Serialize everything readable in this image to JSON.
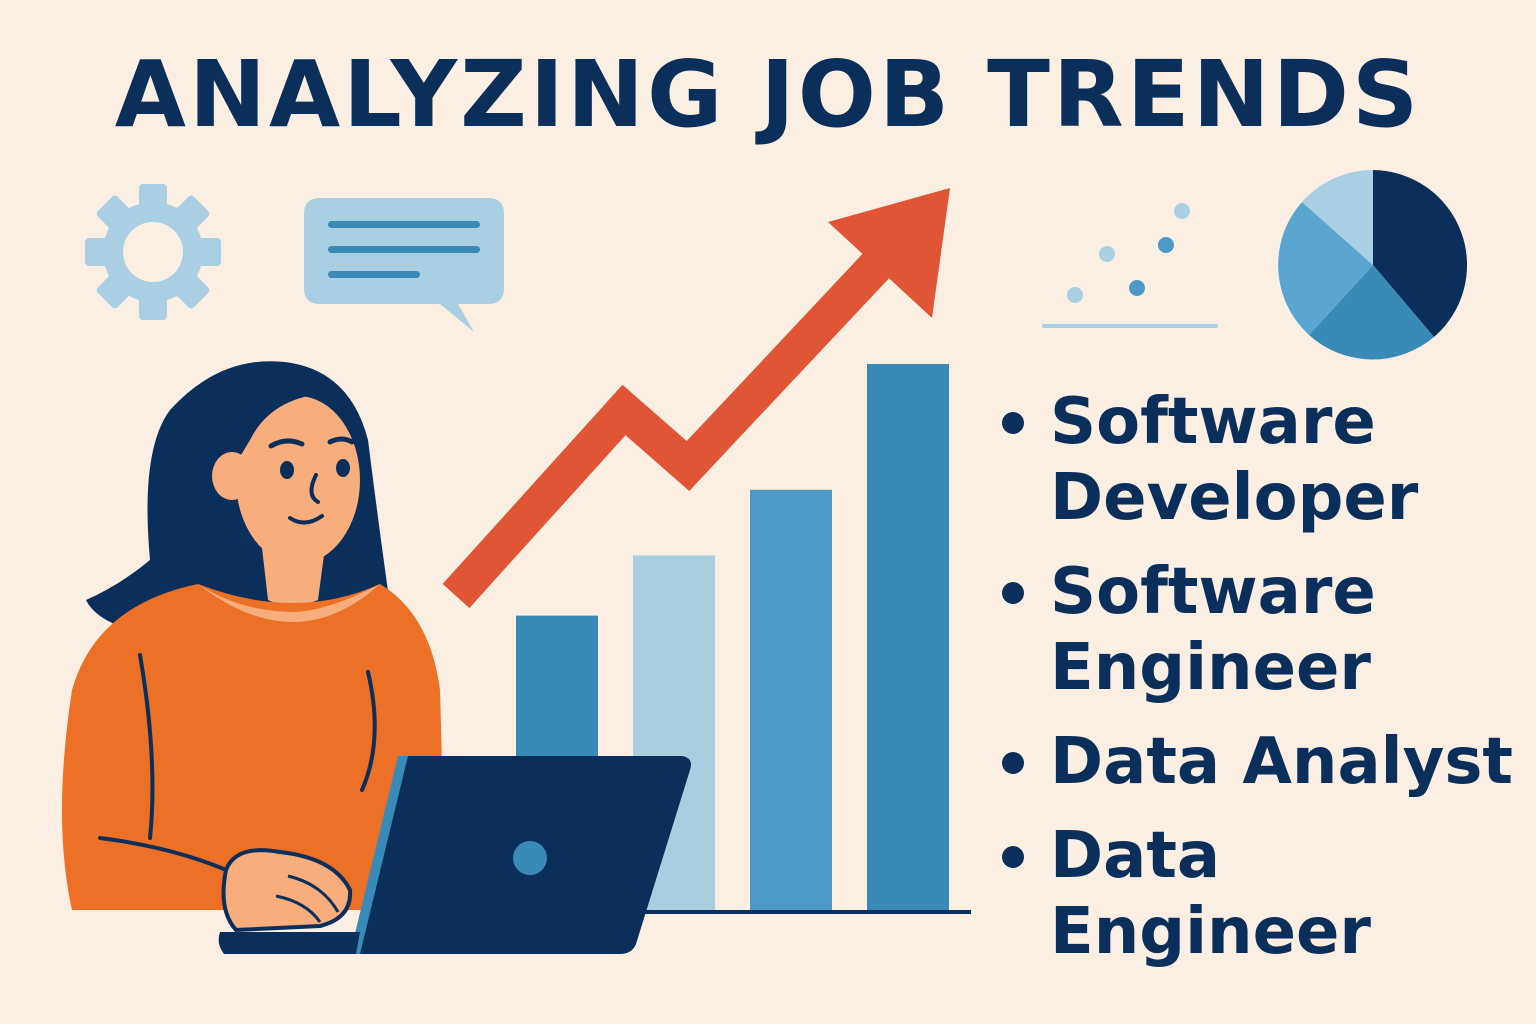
{
  "title": "ANALYZING JOB TRENDS",
  "jobs": [
    {
      "line1": "Software",
      "line2": "Developer"
    },
    {
      "line1": "Software",
      "line2": "Engineer"
    },
    {
      "line1": "Data Analyst",
      "line2": ""
    },
    {
      "line1": "Data",
      "line2": "Engineer"
    }
  ],
  "bar_levels": [
    0.54,
    0.65,
    0.77,
    1.0
  ],
  "colors": {
    "background": "#fbefe3",
    "navy": "#0b2f5b",
    "arrow": "#e05535",
    "shirt": "#ec7026",
    "skin": "#f8ad7c",
    "blue_dark": "#3a8ab8",
    "blue_light": "#a8cfe0",
    "blue_mid": "#4d9ac9"
  },
  "icons": [
    "gear-icon",
    "chat-bubble-icon",
    "scatter-plot-icon",
    "pie-chart-icon",
    "trend-arrow-icon",
    "laptop-icon"
  ]
}
